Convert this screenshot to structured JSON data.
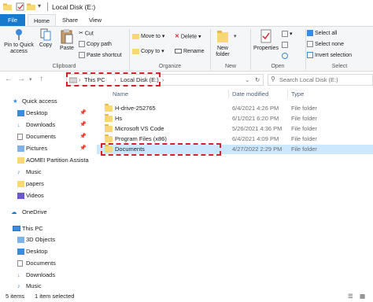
{
  "window": {
    "title": "Local Disk (E:)",
    "controls": [
      "minimize",
      "maximize",
      "close"
    ]
  },
  "tabs": {
    "file": "File",
    "home": "Home",
    "share": "Share",
    "view": "View"
  },
  "ribbon": {
    "clipboard": {
      "pin": "Pin to Quick access",
      "copy": "Copy",
      "paste": "Paste",
      "cut": "Cut",
      "copy_path": "Copy path",
      "paste_shortcut": "Paste shortcut",
      "label": "Clipboard"
    },
    "organize": {
      "move_to": "Move to",
      "copy_to": "Copy to",
      "delete": "Delete",
      "rename": "Rename",
      "label": "Organize"
    },
    "new": {
      "new_folder": "New folder",
      "label": "New"
    },
    "open": {
      "properties": "Properties",
      "label": "Open"
    },
    "select": {
      "select_all": "Select all",
      "select_none": "Select none",
      "invert_selection": "Invert selection",
      "label": "Select"
    }
  },
  "address": {
    "crumbs": [
      "This PC",
      "Local Disk (E:)"
    ],
    "search_placeholder": "Search Local Disk (E:)"
  },
  "nav": {
    "quick_access": "Quick access",
    "quick_items": [
      "Desktop",
      "Downloads",
      "Documents",
      "Pictures",
      "AOMEI Partition Assista",
      "Music",
      "papers",
      "Videos"
    ],
    "onedrive": "OneDrive",
    "this_pc": "This PC",
    "pc_items": [
      "3D Objects",
      "Desktop",
      "Documents",
      "Downloads",
      "Music"
    ]
  },
  "columns": {
    "name": "Name",
    "date": "Date modified",
    "type": "Type"
  },
  "files": [
    {
      "name": "H-drive-252765",
      "date": "6/4/2021 4:26 PM",
      "type": "File folder"
    },
    {
      "name": "Hs",
      "date": "6/1/2021 6:20 PM",
      "type": "File folder"
    },
    {
      "name": "Microsoft VS Code",
      "date": "5/26/2021 4:36 PM",
      "type": "File folder"
    },
    {
      "name": "Program Files (x86)",
      "date": "6/4/2021 4:09 PM",
      "type": "File folder"
    },
    {
      "name": "Documents",
      "date": "4/27/2022 2:29 PM",
      "type": "File folder"
    }
  ],
  "status": {
    "items": "5 items",
    "selected": "1 item selected"
  },
  "colors": {
    "accent": "#1979ca",
    "selection": "#cce8ff",
    "highlight": "#d9212c",
    "folder": "#f8d775"
  }
}
